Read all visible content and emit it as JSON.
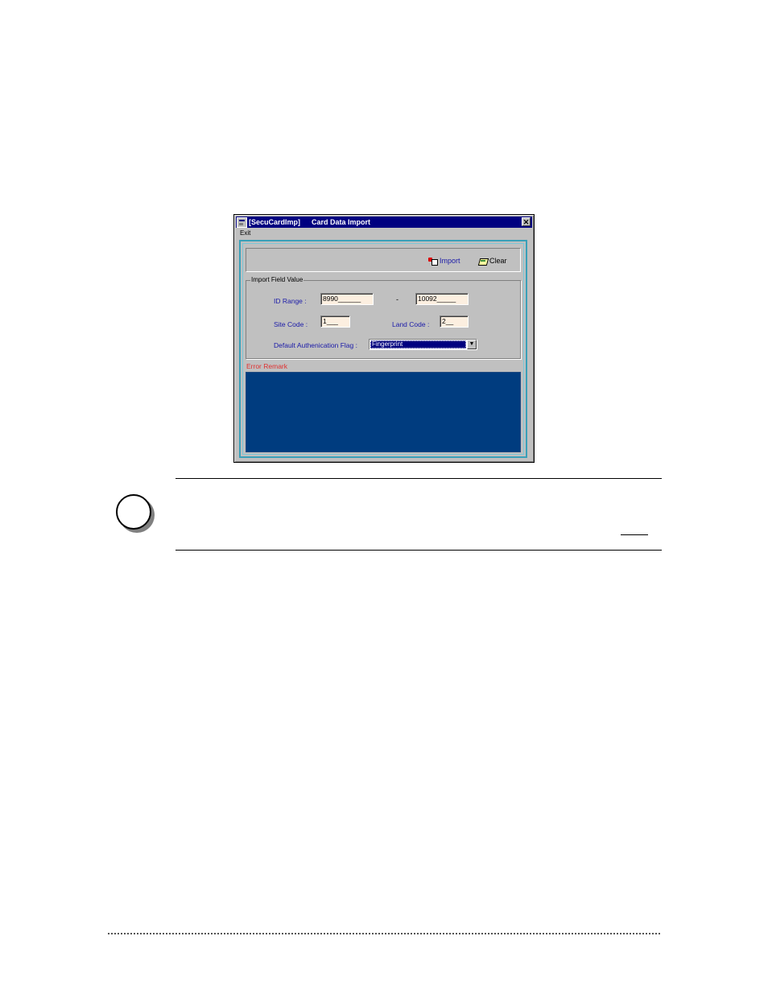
{
  "window": {
    "title_app": "[SecuCardImp]",
    "title_form": "Card Data Import",
    "close_glyph": "✕",
    "menu": {
      "exit": "Exit"
    }
  },
  "toolbar": {
    "import_label": "Import",
    "clear_label": "Clear",
    "import_icon": "import-icon",
    "clear_icon": "clear-icon"
  },
  "import_group": {
    "legend": "Import Field Value",
    "id_range_label": "ID Range :",
    "id_range_from": "8990______",
    "id_range_separator": "-",
    "id_range_to": "10092_____",
    "site_code_label": "Site Code :",
    "site_code_value": "1___",
    "land_code_label": "Land Code :",
    "land_code_value": "2__",
    "auth_flag_label": "Default Authenication Flag :",
    "auth_flag_value": "Fingerprint"
  },
  "error": {
    "label": "Error Remark"
  },
  "colors": {
    "title_bar": "#000080",
    "field_bg": "#fcefe0",
    "error_area": "#003c7f",
    "frame_border": "#3aa0b8",
    "label_blue": "#1a1aa8",
    "error_label": "#e03030"
  }
}
